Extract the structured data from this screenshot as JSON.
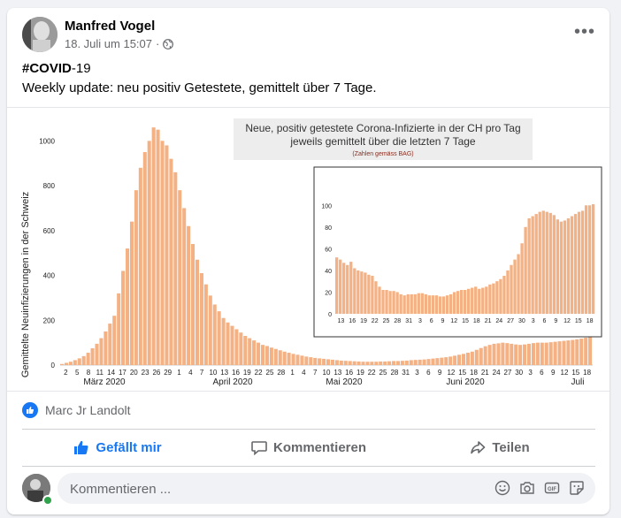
{
  "post": {
    "author": "Manfred Vogel",
    "timestamp": "18. Juli um 15:07",
    "separator": "·",
    "text_line1_tag": "#COVID",
    "text_line1_rest": "-19",
    "text_line2": "Weekly update: neu positiv Getestete, gemittelt über 7 Tage."
  },
  "reactions": {
    "names": "Marc Jr Landolt"
  },
  "actions": {
    "like": "Gefällt mir",
    "comment": "Kommentieren",
    "share": "Teilen"
  },
  "comment": {
    "placeholder": "Kommentieren ..."
  },
  "colors": {
    "accent": "#1877f2",
    "bar": "#f4b183",
    "online": "#31a24c"
  },
  "chart_data": [
    {
      "type": "bar",
      "title": "Neue, positiv getestete Corona-Infizierte in der CH pro Tag",
      "subtitle": "jeweils gemittelt über die letzten 7 Tage",
      "source": "(Zahlen gemäss BAG)",
      "ylabel": "Gemittelte Neuinfizierungen in der Schweiz",
      "ylim": [
        0,
        1100
      ],
      "yticks": [
        0,
        200,
        400,
        600,
        800,
        1000
      ],
      "xtick_labels": [
        "2",
        "5",
        "8",
        "11",
        "14",
        "17",
        "20",
        "23",
        "26",
        "29",
        "1",
        "4",
        "7",
        "10",
        "13",
        "16",
        "19",
        "22",
        "25",
        "28",
        "1",
        "4",
        "7",
        "10",
        "13",
        "16",
        "19",
        "22",
        "25",
        "28",
        "31",
        "3",
        "6",
        "9",
        "12",
        "15",
        "18",
        "21",
        "24",
        "27",
        "30",
        "3",
        "6",
        "9",
        "12",
        "15",
        "18"
      ],
      "months": [
        "März 2020",
        "April 2020",
        "Mai 2020",
        "Juni 2020",
        "Juli"
      ],
      "values": [
        5,
        10,
        15,
        22,
        30,
        40,
        55,
        75,
        95,
        120,
        150,
        185,
        220,
        320,
        420,
        520,
        640,
        780,
        880,
        950,
        1000,
        1060,
        1050,
        1000,
        980,
        920,
        860,
        780,
        700,
        620,
        540,
        470,
        410,
        360,
        310,
        270,
        240,
        210,
        190,
        175,
        160,
        145,
        130,
        120,
        110,
        100,
        90,
        85,
        78,
        72,
        66,
        60,
        55,
        50,
        46,
        42,
        38,
        35,
        32,
        30,
        28,
        26,
        24,
        22,
        20,
        19,
        18,
        17,
        16,
        15,
        15,
        15,
        15,
        16,
        16,
        17,
        18,
        18,
        19,
        20,
        22,
        23,
        24,
        25,
        27,
        29,
        31,
        33,
        35,
        38,
        42,
        46,
        50,
        55,
        60,
        68,
        76,
        84,
        90,
        95,
        97,
        100,
        98,
        95,
        92,
        90,
        92,
        95,
        98,
        100,
        100,
        100,
        102,
        104,
        106,
        108,
        110,
        112,
        115,
        118,
        122,
        126
      ]
    },
    {
      "type": "bar",
      "title": "",
      "ylim": [
        0,
        110
      ],
      "yticks": [
        0,
        20,
        40,
        60,
        80,
        100
      ],
      "xtick_labels": [
        "13",
        "16",
        "19",
        "22",
        "25",
        "28",
        "31",
        "3",
        "6",
        "9",
        "12",
        "15",
        "18",
        "21",
        "24",
        "27",
        "30",
        "3",
        "6",
        "9",
        "12",
        "15",
        "18"
      ],
      "values": [
        52,
        50,
        47,
        45,
        48,
        42,
        40,
        39,
        38,
        36,
        35,
        30,
        25,
        22,
        22,
        21,
        21,
        20,
        18,
        17,
        18,
        18,
        18,
        19,
        19,
        18,
        17,
        17,
        17,
        16,
        16,
        17,
        18,
        20,
        21,
        22,
        22,
        23,
        24,
        25,
        23,
        24,
        25,
        27,
        28,
        30,
        32,
        35,
        40,
        45,
        50,
        55,
        65,
        80,
        88,
        90,
        92,
        94,
        95,
        94,
        93,
        91,
        87,
        85,
        86,
        88,
        90,
        92,
        94,
        95,
        100,
        100,
        101
      ]
    }
  ]
}
